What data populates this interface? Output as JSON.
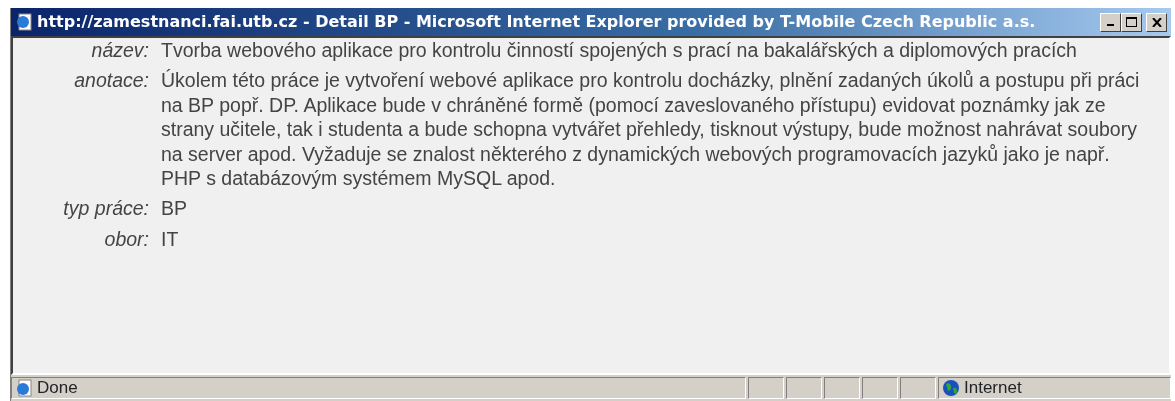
{
  "window": {
    "title": "http://zamestnanci.fai.utb.cz - Detail BP - Microsoft Internet Explorer provided by T-Mobile Czech Republic a.s."
  },
  "fields": [
    {
      "label": "název:",
      "value": "Tvorba webového aplikace pro kontrolu činností spojených s prací na bakalářských a diplomových pracích"
    },
    {
      "label": "anotace:",
      "value": "Úkolem této práce je vytvoření webové aplikace pro kontrolu docházky, plnění zadaných úkolů a postupu při práci na BP popř. DP. Aplikace bude v chráněné formě (pomocí zaveslovaného přístupu) evidovat poznámky jak ze strany učitele, tak i studenta a bude schopna vytvářet přehledy, tisknout výstupy, bude možnost nahrávat soubory na server apod. Vyžaduje se znalost některého z dynamických webových programovacích jazyků jako je např. PHP s databázovým systémem MySQL apod."
    },
    {
      "label": "typ práce:",
      "value": "BP"
    },
    {
      "label": "obor:",
      "value": "IT"
    }
  ],
  "status_bar": {
    "status": "Done",
    "zone": "Internet"
  }
}
